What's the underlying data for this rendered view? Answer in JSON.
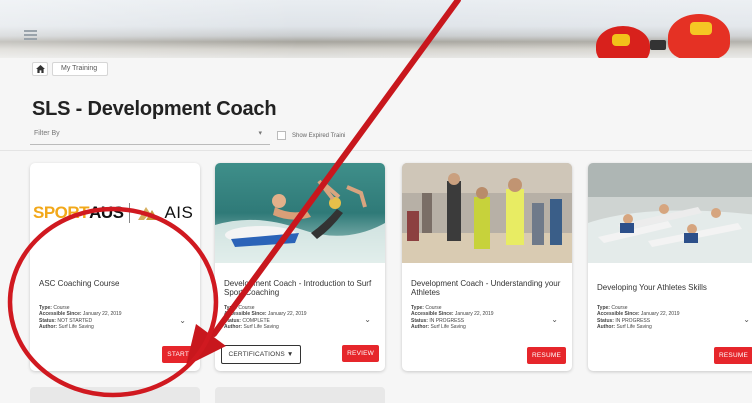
{
  "breadcrumb": {
    "home_icon": "home-icon",
    "items": [
      "My Training"
    ]
  },
  "page": {
    "title": "SLS - Development Coach"
  },
  "filter": {
    "placeholder": "Filter By",
    "show_expired_label": "Show Expired Traini"
  },
  "cards": [
    {
      "title": "ASC Coaching Course",
      "type_label": "Type:",
      "type": "Course",
      "since_label": "Accessible Since:",
      "since": "January 22, 2019",
      "status_label": "Status:",
      "status": "NOT STARTED",
      "author_label": "Author:",
      "author": "Surf Life Saving",
      "logo_sport": "SPORT",
      "logo_aus": "AUS",
      "logo_ais": "AIS",
      "action": "START"
    },
    {
      "title": "Development Coach - Introduction to Surf Sport Coaching",
      "type_label": "Type:",
      "type": "Course",
      "since_label": "Accessible Since:",
      "since": "January 22, 2019",
      "status_label": "Status:",
      "status": "COMPLETE",
      "author_label": "Author:",
      "author": "Surf Life Saving",
      "secondary_action": "CERTIFICATIONS ▼",
      "action": "REVIEW"
    },
    {
      "title": "Development Coach - Understanding your Athletes",
      "type_label": "Type:",
      "type": "Course",
      "since_label": "Accessible Since:",
      "since": "January 22, 2019",
      "status_label": "Status:",
      "status": "IN PROGRESS",
      "author_label": "Author:",
      "author": "Surf Life Saving",
      "action": "RESUME"
    },
    {
      "title": "Developing Your Athletes Skills",
      "type_label": "Type:",
      "type": "Course",
      "since_label": "Accessible Since:",
      "since": "January 22, 2019",
      "status_label": "Status:",
      "status": "IN PROGRESS",
      "author_label": "Author:",
      "author": "Surf Life Saving",
      "action": "RESUME"
    }
  ],
  "colors": {
    "accent_red": "#e6262b",
    "annotation_red": "#c8171d",
    "logo_orange": "#f2a81a"
  },
  "icons": [
    "hamburger-menu-icon",
    "home-icon",
    "chevron-down-icon",
    "caret-down-icon"
  ]
}
